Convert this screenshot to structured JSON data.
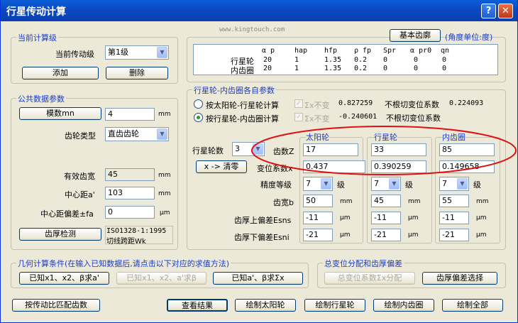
{
  "window": {
    "title": "行星传动计算",
    "help": "?",
    "close": "✕"
  },
  "watermark": "www.kingtouch.com",
  "current_level": {
    "group": "当前计算级",
    "label": "当前传动级",
    "value": "第1级",
    "add": "添加",
    "delete": "删除"
  },
  "common": {
    "group": "公共数据参数",
    "module_btn": "模数mn",
    "module_value": "4",
    "module_unit": "mm",
    "tooth_type_label": "齿轮类型",
    "tooth_type_value": "直齿齿轮",
    "eff_label": "有效齿宽",
    "eff_value": "45",
    "eff_unit": "mm",
    "center_label": "中心距a'",
    "center_value": "103",
    "center_unit": "mm",
    "dev_label": "中心距偏差±fa",
    "dev_value": "0",
    "dev_unit": "μm",
    "inspect_btn": "齿厚检测",
    "inspect_line1": "ISO1328-1:1995",
    "inspect_line2": "切线跨距Wk"
  },
  "basic": {
    "btn": "基本齿廓",
    "unit_note": "(角度单位:度)",
    "headers": [
      "α p",
      "hap",
      "hfp",
      "ρ fp",
      "Spr",
      "α pr0",
      "qn"
    ],
    "rows": [
      {
        "name": "行星轮",
        "vals": [
          "20",
          "1",
          "1.35",
          "0.2",
          "0",
          "0",
          "0"
        ]
      },
      {
        "name": "内齿圈",
        "vals": [
          "20",
          "1",
          "1.35",
          "0.2",
          "0",
          "0",
          "0"
        ]
      }
    ]
  },
  "params": {
    "group": "行星轮-内齿圈各自参数",
    "radio1": "按太阳轮-行星轮计算",
    "radio2": "按行星轮-内齿圈计算",
    "chk1": "Σx不变",
    "val1": "0.827259",
    "note1": "不根切变位系数",
    "val1b": "0.224093",
    "chk2": "Σx不变",
    "val2": "-0.240601",
    "note2": "不根切变位系数",
    "planet_count_label": "行星轮数",
    "planet_count": "3",
    "clear_btn": "x -> 清零",
    "cols": [
      "太阳轮",
      "行星轮",
      "内齿圈"
    ],
    "teeth_label": "齿数Z",
    "teeth": [
      "17",
      "33",
      "85"
    ],
    "shift_label": "变位系数x",
    "shift": [
      "0.437",
      "0.390259",
      "0.149658"
    ],
    "grade_label": "精度等级",
    "grade": [
      "7",
      "7",
      "7"
    ],
    "grade_unit": "级",
    "width_label": "齿宽b",
    "width": [
      "50",
      "45",
      "55"
    ],
    "width_unit": "mm",
    "upper_label": "齿厚上偏差Esns",
    "upper": [
      "-11",
      "-11",
      "-11"
    ],
    "lower_label": "齿厚下偏差Esni",
    "lower": [
      "-21",
      "-21",
      "-21"
    ],
    "dev_unit": "μm"
  },
  "geom": {
    "group": "几何计算条件(在输入已知数据后,请点击以下对应的求值方法)",
    "btn1": "已知x1、x2、β求a'",
    "btn2": "已知x1、x2、a'求β",
    "btn3": "已知a'、β求Σx"
  },
  "shiftdist": {
    "group": "总变位分配和齿厚偏差",
    "btn1": "总变位系数Σx分配",
    "btn2": "齿厚偏差选择"
  },
  "bottom": {
    "match": "按传动比匹配齿数",
    "view": "查看结果",
    "draw_sun": "绘制太阳轮",
    "draw_planet": "绘制行星轮",
    "draw_ring": "绘制内齿圈",
    "draw_all": "绘制全部"
  },
  "annotation_color": "#e01010"
}
